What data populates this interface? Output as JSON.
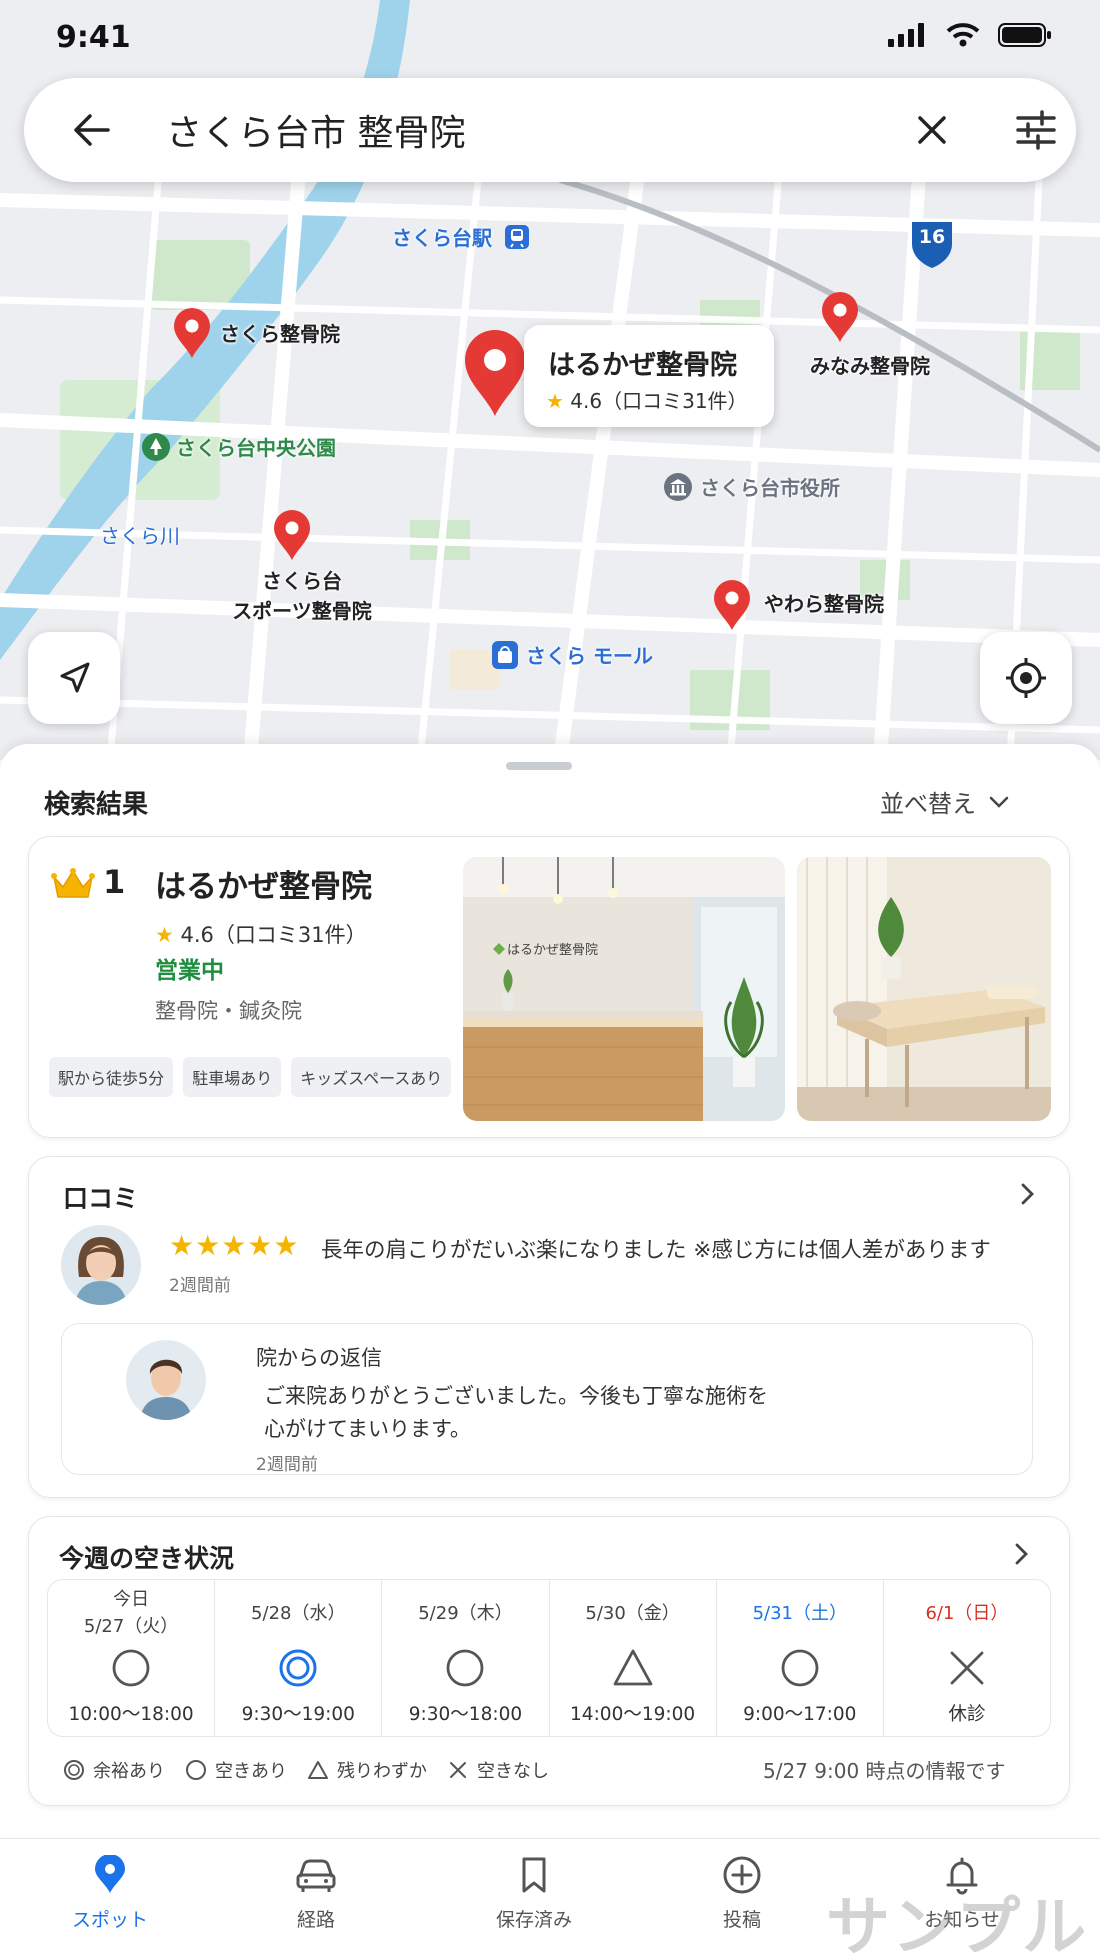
{
  "status_bar": {
    "time": "9:41"
  },
  "search": {
    "query": "さくら台市 整骨院"
  },
  "map": {
    "pins": [
      {
        "label": "さくら整骨院"
      },
      {
        "label": "みなみ整骨院"
      },
      {
        "label_line1": "さくら台",
        "label_line2": "スポーツ整骨院"
      },
      {
        "label": "やわら整骨院"
      }
    ],
    "selected": {
      "name": "はるかぜ整骨院",
      "rating": "4.6（口コミ31件）"
    },
    "pois": {
      "station": "さくら台駅",
      "park": "さくら台中央公園",
      "river": "さくら川",
      "city_hall": "さくら台市役所",
      "mall": "さくら モール",
      "route": "16"
    }
  },
  "sheet": {
    "title": "検索結果",
    "sort_label": "並べ替え"
  },
  "result": {
    "rank": "1",
    "name": "はるかぜ整骨院",
    "rating": "4.6（口コミ31件）",
    "open_status": "営業中",
    "category": "整骨院・鍼灸院",
    "chips": [
      "駅から徒歩5分",
      "駐車場あり",
      "キッズスペースあり"
    ],
    "photo_sign": "はるかぜ整骨院",
    "colors": {
      "open": "#1e8e3e",
      "star": "#f4b400"
    }
  },
  "reviews": {
    "title": "口コミ",
    "stars": "★★★★★",
    "text": "長年の肩こりがだいぶ楽になりました ※感じ方には個人差があります",
    "ago": "2週間前",
    "reply": {
      "title": "院からの返信",
      "text_line1": "ご来院ありがとうございました。今後も丁寧な施術を",
      "text_line2": "心がけてまいります。",
      "ago": "2週間前"
    }
  },
  "availability": {
    "title": "今週の空き状況",
    "days": [
      {
        "label_line1": "今日",
        "label_line2": "5/27（火）",
        "symbol": "circle",
        "hours": "10:00〜18:00",
        "color": "#444444"
      },
      {
        "label_line1": "5/28（水）",
        "label_line2": "",
        "symbol": "double-circle",
        "hours": "9:30〜19:00",
        "color": "#444444"
      },
      {
        "label_line1": "5/29（木）",
        "label_line2": "",
        "symbol": "circle",
        "hours": "9:30〜18:00",
        "color": "#444444"
      },
      {
        "label_line1": "5/30（金）",
        "label_line2": "",
        "symbol": "triangle",
        "hours": "14:00〜19:00",
        "color": "#444444"
      },
      {
        "label_line1": "5/31（土）",
        "label_line2": "",
        "symbol": "circle",
        "hours": "9:00〜17:00",
        "color": "#1a73e8"
      },
      {
        "label_line1": "6/1（日）",
        "label_line2": "",
        "symbol": "cross",
        "hours": "休診",
        "color": "#d93025"
      }
    ],
    "legend": [
      "余裕あり",
      "空きあり",
      "残りわずか",
      "空きなし"
    ],
    "as_of": "5/27 9:00 時点の情報です"
  },
  "nav": {
    "items": [
      {
        "label": "スポット",
        "icon": "pin-icon",
        "active": true
      },
      {
        "label": "経路",
        "icon": "car-icon"
      },
      {
        "label": "保存済み",
        "icon": "bookmark-icon"
      },
      {
        "label": "投稿",
        "icon": "plus-circle-icon"
      },
      {
        "label": "お知らせ",
        "icon": "bell-icon"
      }
    ],
    "accent": "#1a73e8"
  },
  "watermark": "サンプル"
}
